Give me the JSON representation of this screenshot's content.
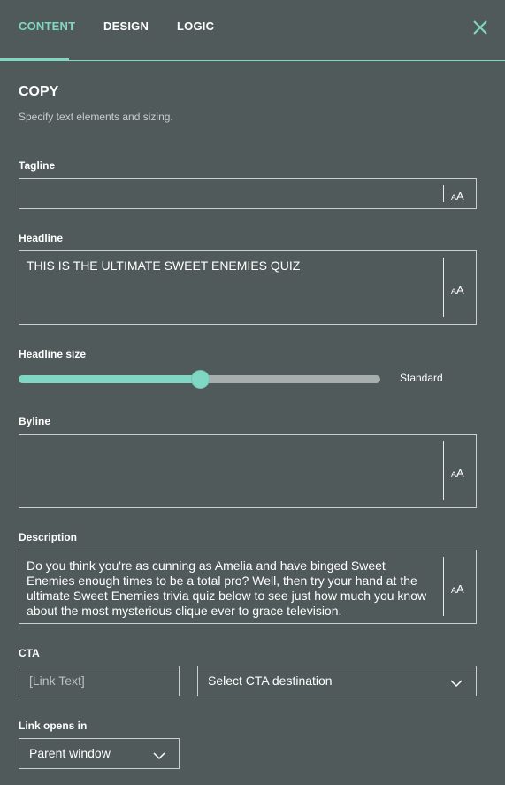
{
  "tabs": [
    {
      "label": "CONTENT",
      "active": true
    },
    {
      "label": "DESIGN",
      "active": false
    },
    {
      "label": "LOGIC",
      "active": false
    }
  ],
  "section": {
    "title": "COPY",
    "subtitle": "Specify text elements and sizing."
  },
  "fields": {
    "tagline": {
      "label": "Tagline",
      "value": ""
    },
    "headline": {
      "label": "Headline",
      "value": "THIS IS THE ULTIMATE SWEET ENEMIES QUIZ"
    },
    "headline_size": {
      "label": "Headline size",
      "value_label": "Standard",
      "level": 0.5
    },
    "byline": {
      "label": "Byline",
      "value": ""
    },
    "description": {
      "label": "Description",
      "value": "Do you think you're as cunning as Amelia and have binged Sweet Enemies enough times to be a total pro? Well, then try your hand at the ultimate Sweet Enemies trivia quiz below to see just how much you know about the most mysterious clique ever to grace television."
    },
    "cta": {
      "label": "CTA",
      "link_placeholder": "[Link Text]",
      "destination": "Select CTA destination"
    },
    "link_opens_in": {
      "label": "Link opens in",
      "value": "Parent window"
    }
  },
  "icons": {
    "close": "close-icon",
    "font_size": "font-size-icon",
    "dropdown": "chevron-down-icon"
  },
  "colors": {
    "background": "#515a5a",
    "accent": "#7fd7c4",
    "border": "#c9cfcf",
    "muted_text": "#c6cccc"
  }
}
